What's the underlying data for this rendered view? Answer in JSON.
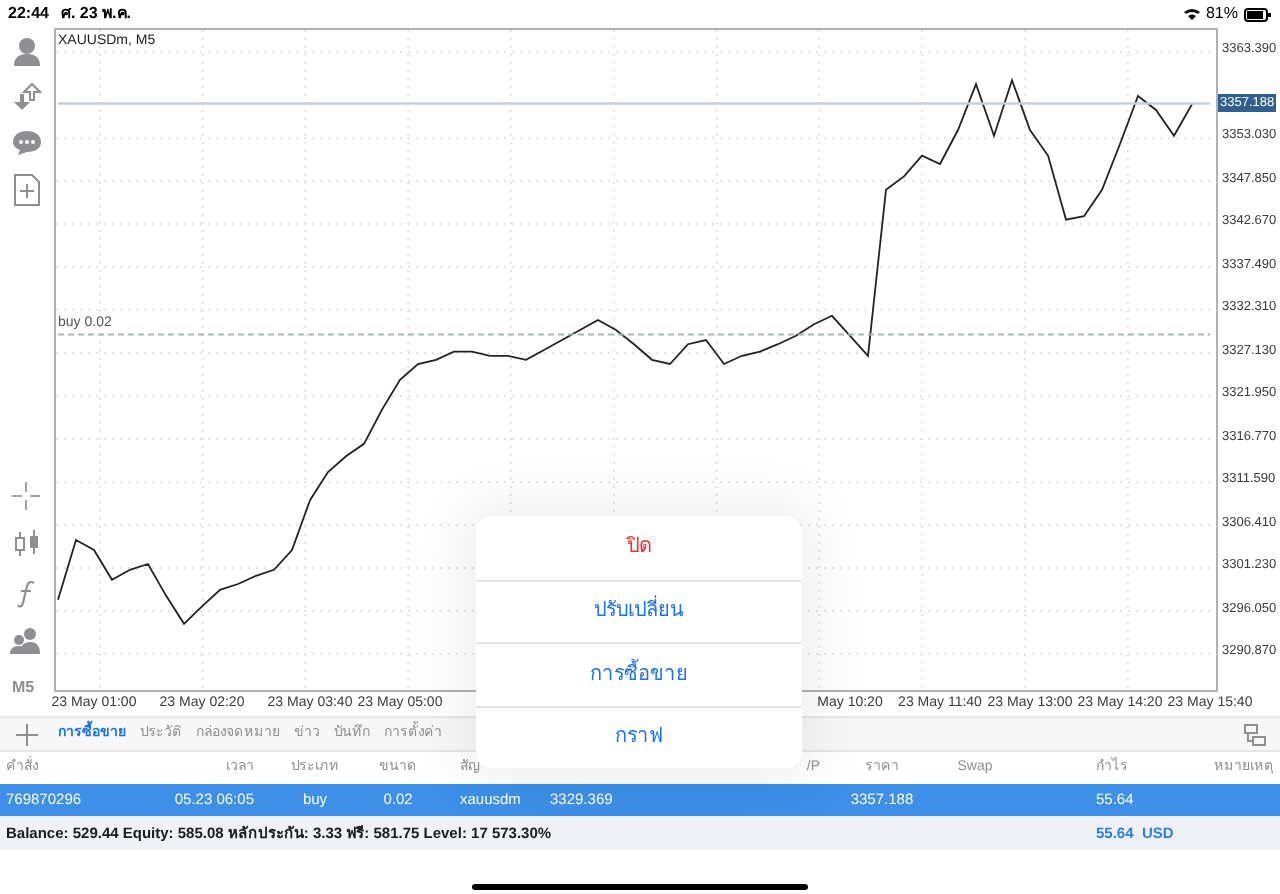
{
  "status_bar": {
    "time": "22:44",
    "date": "ศ. 23 พ.ค.",
    "battery": "81%"
  },
  "toolbar": {
    "timeframe": "M5"
  },
  "chart": {
    "chart_data": {
      "type": "line",
      "title": "XAUUSDm, M5",
      "grid": true,
      "categories": [
        null,
        null,
        "23 May 01:00",
        null,
        null,
        null,
        null,
        null,
        "23 May 02:20",
        null,
        null,
        null,
        null,
        null,
        "23 May 03:40",
        null,
        null,
        null,
        null,
        "23 May 05:00",
        null,
        null,
        null,
        null,
        null,
        null,
        null,
        null,
        null,
        null,
        null,
        null,
        null,
        null,
        null,
        null,
        null,
        null,
        null,
        null,
        null,
        null,
        null,
        null,
        "May 10:20",
        null,
        null,
        null,
        null,
        "23 May 11:40",
        null,
        null,
        null,
        null,
        "23 May 13:00",
        null,
        null,
        null,
        null,
        "23 May 14:20",
        null,
        null,
        null,
        null,
        "23 May 15:40"
      ],
      "ylim": [
        3286.29,
        3366.28
      ],
      "yticks": [
        {
          "value": 3363.39,
          "label": "3363.390"
        },
        {
          "value": 3353.03,
          "label": "3353.030"
        },
        {
          "value": 3347.85,
          "label": "3347.850"
        },
        {
          "value": 3342.67,
          "label": "3342.670"
        },
        {
          "value": 3337.49,
          "label": "3337.490"
        },
        {
          "value": 3332.31,
          "label": "3332.310"
        },
        {
          "value": 3327.13,
          "label": "3327.130"
        },
        {
          "value": 3321.95,
          "label": "3321.950"
        },
        {
          "value": 3316.77,
          "label": "3316.770"
        },
        {
          "value": 3311.59,
          "label": "3311.590"
        },
        {
          "value": 3306.41,
          "label": "3306.410"
        },
        {
          "value": 3301.23,
          "label": "3301.230"
        },
        {
          "value": 3296.05,
          "label": "3296.050"
        },
        {
          "value": 3290.87,
          "label": "3290.870"
        }
      ],
      "series": [
        {
          "color": "#222222",
          "values": [
            3297.4,
            3304.6,
            3303.4,
            3299.8,
            3301.0,
            3301.7,
            3297.9,
            3294.5,
            3296.6,
            3298.6,
            3299.3,
            3300.3,
            3301.0,
            3303.4,
            3309.4,
            3312.8,
            3314.7,
            3316.2,
            3320.3,
            3323.9,
            3325.8,
            3326.3,
            3327.3,
            3327.3,
            3326.8,
            3326.8,
            3326.3,
            3327.5,
            3328.7,
            3329.9,
            3331.1,
            3329.9,
            3328.2,
            3326.3,
            3325.8,
            3328.2,
            3328.7,
            3325.8,
            3326.8,
            3327.3,
            3328.2,
            3329.2,
            3330.6,
            3331.6,
            3329.2,
            3326.8,
            3346.8,
            3348.4,
            3350.9,
            3349.9,
            3354.0,
            3359.5,
            3353.3,
            3360.0,
            3354.0,
            3350.9,
            3343.2,
            3343.6,
            3346.8,
            3352.3,
            3358.1,
            3356.4,
            3353.3,
            3357.1,
            null
          ]
        },
        {
          "name": "3357.188",
          "color": "#c5d0dc",
          "line_style": "solid",
          "values": [
            3357.188,
            3357.188,
            3357.188,
            3357.188,
            3357.188,
            3357.188,
            3357.188,
            3357.188,
            3357.188,
            3357.188,
            3357.188,
            3357.188,
            3357.188,
            3357.188,
            3357.188,
            3357.188,
            3357.188,
            3357.188,
            3357.188,
            3357.188,
            3357.188,
            3357.188,
            3357.188,
            3357.188,
            3357.188,
            3357.188,
            3357.188,
            3357.188,
            3357.188,
            3357.188,
            3357.188,
            3357.188,
            3357.188,
            3357.188,
            3357.188,
            3357.188,
            3357.188,
            3357.188,
            3357.188,
            3357.188,
            3357.188,
            3357.188,
            3357.188,
            3357.188,
            3357.188,
            3357.188,
            3357.188,
            3357.188,
            3357.188,
            3357.188,
            3357.188,
            3357.188,
            3357.188,
            3357.188,
            3357.188,
            3357.188,
            3357.188,
            3357.188,
            3357.188,
            3357.188,
            3357.188,
            3357.188,
            3357.188,
            3357.188,
            3357.188
          ]
        },
        {
          "name": "buy 0.02",
          "color": "#a9b5b0",
          "line_style": "dashed",
          "values": [
            3329.369,
            3329.369,
            3329.369,
            3329.369,
            3329.369,
            3329.369,
            3329.369,
            3329.369,
            3329.369,
            3329.369,
            3329.369,
            3329.369,
            3329.369,
            3329.369,
            3329.369,
            3329.369,
            3329.369,
            3329.369,
            3329.369,
            3329.369,
            3329.369,
            3329.369,
            3329.369,
            3329.369,
            3329.369,
            3329.369,
            3329.369,
            3329.369,
            3329.369,
            3329.369,
            3329.369,
            3329.369,
            3329.369,
            3329.369,
            3329.369,
            3329.369,
            3329.369,
            3329.369,
            3329.369,
            3329.369,
            3329.369,
            3329.369,
            3329.369,
            3329.369,
            3329.369,
            3329.369,
            3329.369,
            3329.369,
            3329.369,
            3329.369,
            3329.369,
            3329.369,
            3329.369,
            3329.369,
            3329.369,
            3329.369,
            3329.369,
            3329.369,
            3329.369,
            3329.369,
            3329.369,
            3329.369,
            3329.369,
            3329.369,
            3329.369
          ]
        }
      ]
    }
  },
  "tabs": [
    {
      "label": "การซื้อขาย",
      "selected": true
    },
    {
      "label": "ประวัติ",
      "selected": false
    },
    {
      "label": "กล่องจดหมาย",
      "selected": false
    },
    {
      "label": "ข่าว",
      "selected": false
    },
    {
      "label": "บันทึก",
      "selected": false
    },
    {
      "label": "การตั้งค่า",
      "selected": false
    }
  ],
  "table": {
    "columns": [
      {
        "label": "คำสั่ง"
      },
      {
        "label": "เวลา"
      },
      {
        "label": "ประเภท"
      },
      {
        "label": "ขนาด"
      },
      {
        "label": "สัญ"
      },
      {},
      {},
      {
        "label": "/P"
      },
      {
        "label": "ราคา"
      },
      {
        "label": "Swap"
      },
      {
        "label": "กำไร"
      },
      {
        "label": "หมายเหตุ"
      }
    ],
    "rows": [
      {
        "selected": true,
        "cells": [
          "769870296",
          "05.23 06:05",
          "buy",
          "0.02",
          "xauusdm",
          "3329.369",
          "",
          "",
          "3357.188",
          "",
          "55.64",
          ""
        ]
      }
    ]
  },
  "summary": {
    "text": "Balance: 529.44 Equity: 585.08 หลักประกัน: 3.33 ฟรี: 581.75 Level: 17 573.30%",
    "profit": "55.64",
    "currency": "USD"
  },
  "menu": {
    "items": [
      {
        "label": "ปิด",
        "kind": "destructive"
      },
      {
        "label": "ปรับเปลี่ยน",
        "kind": "normal"
      },
      {
        "label": "การซื้อขาย",
        "kind": "normal"
      },
      {
        "label": "กราฟ",
        "kind": "normal"
      }
    ]
  }
}
